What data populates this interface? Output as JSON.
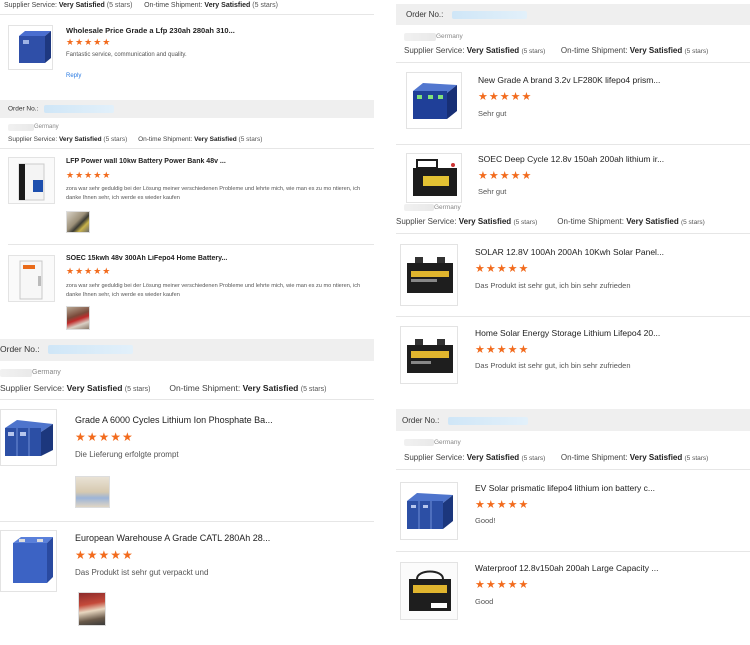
{
  "labels": {
    "order_no": "Order No.:",
    "supplier_service": "Supplier Service:",
    "ontime_shipment": "On-time Shipment:",
    "very_satisfied": "Very Satisfied",
    "five_stars": "(5 stars)",
    "country": "Germany",
    "reply": "Reply",
    "stars": "★★★★★"
  },
  "left": {
    "review1": {
      "title": "Wholesale Price Grade a Lfp 230ah 280ah 310...",
      "text": "Fantastic service, communication and quality."
    },
    "review2": {
      "title": "LFP Power wall 10kw Battery Power Bank 48v ...",
      "text": "zora war sehr geduldig bei der Lösung meiner verschiedenen Probleme und lehrte mich, wie man es zu mo ntieren, ich danke Ihnen sehr, ich werde es wieder kaufen"
    },
    "review3": {
      "title": "SOEC 15kwh 48v 300Ah LiFepo4 Home Battery...",
      "text": "zora war sehr geduldig bei der Lösung meiner verschiedenen Probleme und lehrte mich, wie man es zu mo ntieren, ich danke Ihnen sehr, ich werde es wieder kaufen"
    },
    "review4": {
      "title": "Grade A 6000 Cycles Lithium Ion Phosphate Ba...",
      "text": "Die Lieferung erfolgte prompt"
    },
    "review5": {
      "title": "European Warehouse A Grade CATL 280Ah 28...",
      "text": "Das Produkt ist sehr gut verpackt und"
    }
  },
  "right": {
    "review1": {
      "title": "New Grade A brand 3.2v LF280K lifepo4 prism...",
      "text": "Sehr gut"
    },
    "review2": {
      "title": "SOEC Deep Cycle 12.8v 150ah 200ah lithium ir...",
      "text": "Sehr gut"
    },
    "review3": {
      "title": "SOLAR 12.8V 100Ah 200Ah 10Kwh Solar Panel...",
      "text": "Das Produkt ist sehr gut, ich bin sehr zufrieden"
    },
    "review4": {
      "title": "Home Solar Energy Storage Lithium Lifepo4 20...",
      "text": "Das Produkt ist sehr gut, ich bin sehr zufrieden"
    },
    "review5": {
      "title": "EV Solar prismatic lifepo4 lithium ion battery c...",
      "text": "Good!"
    },
    "review6": {
      "title": "Waterproof 12.8v150ah 200ah Large Capacity ...",
      "text": "Good"
    }
  },
  "colors": {
    "star": "#f26b1d",
    "order_bar": "#efefef",
    "link": "#2a7ae2"
  }
}
